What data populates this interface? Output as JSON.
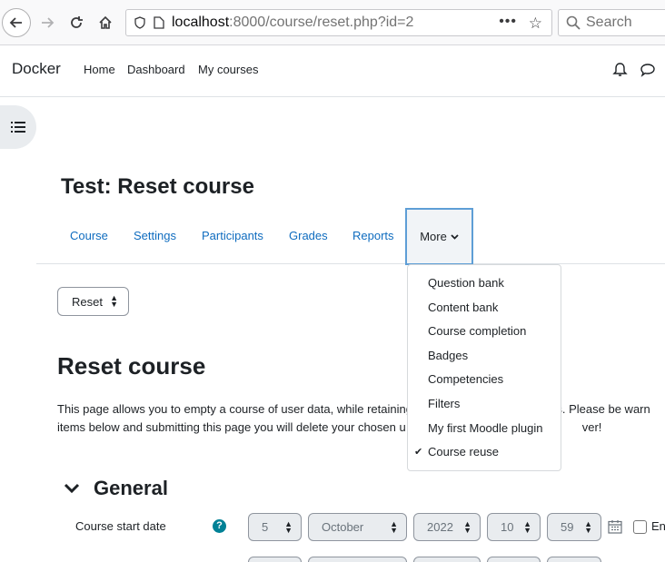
{
  "browser": {
    "url_host": "localhost",
    "url_rest": ":8000/course/reset.php?id=2",
    "search_placeholder": "Search",
    "page_actions": "•••"
  },
  "navbar": {
    "brand": "Docker",
    "links": [
      "Home",
      "Dashboard",
      "My courses"
    ]
  },
  "course": {
    "title": "Test: Reset course"
  },
  "secondary_nav": {
    "items": [
      "Course",
      "Settings",
      "Participants",
      "Grades",
      "Reports"
    ],
    "more_label": "More"
  },
  "more_menu": {
    "items": [
      {
        "label": "Question bank",
        "checked": false
      },
      {
        "label": "Content bank",
        "checked": false
      },
      {
        "label": "Course completion",
        "checked": false
      },
      {
        "label": "Badges",
        "checked": false
      },
      {
        "label": "Competencies",
        "checked": false
      },
      {
        "label": "Filters",
        "checked": false
      },
      {
        "label": "My first Moodle plugin",
        "checked": false
      },
      {
        "label": "Course reuse",
        "checked": true
      }
    ]
  },
  "reuse_select": {
    "value": "Reset"
  },
  "page": {
    "heading": "Reset course",
    "intro_line1": "This page allows you to empty a course of user data, while retaining",
    "intro_line1_end": "ngs. Please be warn",
    "intro_line2": "items below and submitting this page you will delete your chosen u",
    "intro_line2_end": "ver!"
  },
  "general": {
    "heading": "General",
    "start_date_label": "Course start date",
    "help_glyph": "?",
    "day": "5",
    "month": "October",
    "year": "2022",
    "hour": "10",
    "minute": "59",
    "enable_label": "Enable"
  },
  "colors": {
    "link": "#0f6cbf",
    "help": "#008196",
    "more_focus_border": "#5e9ed6"
  }
}
